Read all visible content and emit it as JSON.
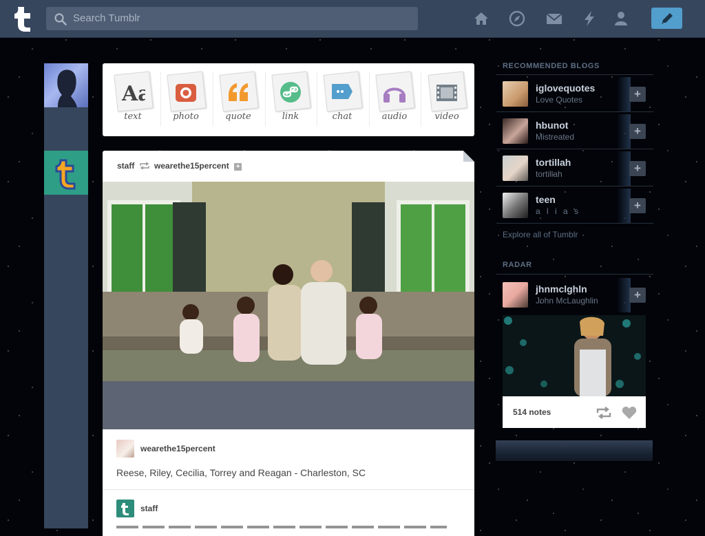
{
  "header": {
    "search_placeholder": "Search Tumblr",
    "nav_icons": [
      "home-icon",
      "explore-icon",
      "inbox-icon",
      "activity-icon",
      "account-icon"
    ],
    "compose_icon": "pencil-icon"
  },
  "post_types": [
    {
      "label": "text",
      "icon": "text-icon",
      "color": "#444444"
    },
    {
      "label": "photo",
      "icon": "camera-icon",
      "color": "#d95e40"
    },
    {
      "label": "quote",
      "icon": "quote-icon",
      "color": "#f2992e"
    },
    {
      "label": "link",
      "icon": "link-icon",
      "color": "#56bc8a"
    },
    {
      "label": "chat",
      "icon": "chat-icon",
      "color": "#529ecc"
    },
    {
      "label": "audio",
      "icon": "audio-icon",
      "color": "#a77dc2"
    },
    {
      "label": "video",
      "icon": "video-icon",
      "color": "#748089"
    }
  ],
  "post": {
    "reblogger": "staff",
    "source": "wearethe15percent",
    "source_name": "wearethe15percent",
    "caption": "Reese, Riley, Cecilia, Torrey and Reagan - Charleston, SC",
    "trail_name": "staff"
  },
  "sidebar": {
    "recommended_title": "RECOMMENDED BLOGS",
    "blogs": [
      {
        "name": "iglovequotes",
        "subtitle": "Love Quotes"
      },
      {
        "name": "hbunot",
        "subtitle": "Mistreated"
      },
      {
        "name": "tortillah",
        "subtitle": "tortillah"
      },
      {
        "name": "teen",
        "subtitle": "a l i a s"
      }
    ],
    "add_label": "+",
    "explore_label": "Explore all of Tumblr",
    "radar_title": "RADAR",
    "radar": {
      "name": "jhnmclghln",
      "subtitle": "John McLaughlin",
      "notes": "514 notes"
    }
  },
  "colors": {
    "navy": "#36465d",
    "accent_blue": "#529ecc",
    "background": "#020409"
  }
}
